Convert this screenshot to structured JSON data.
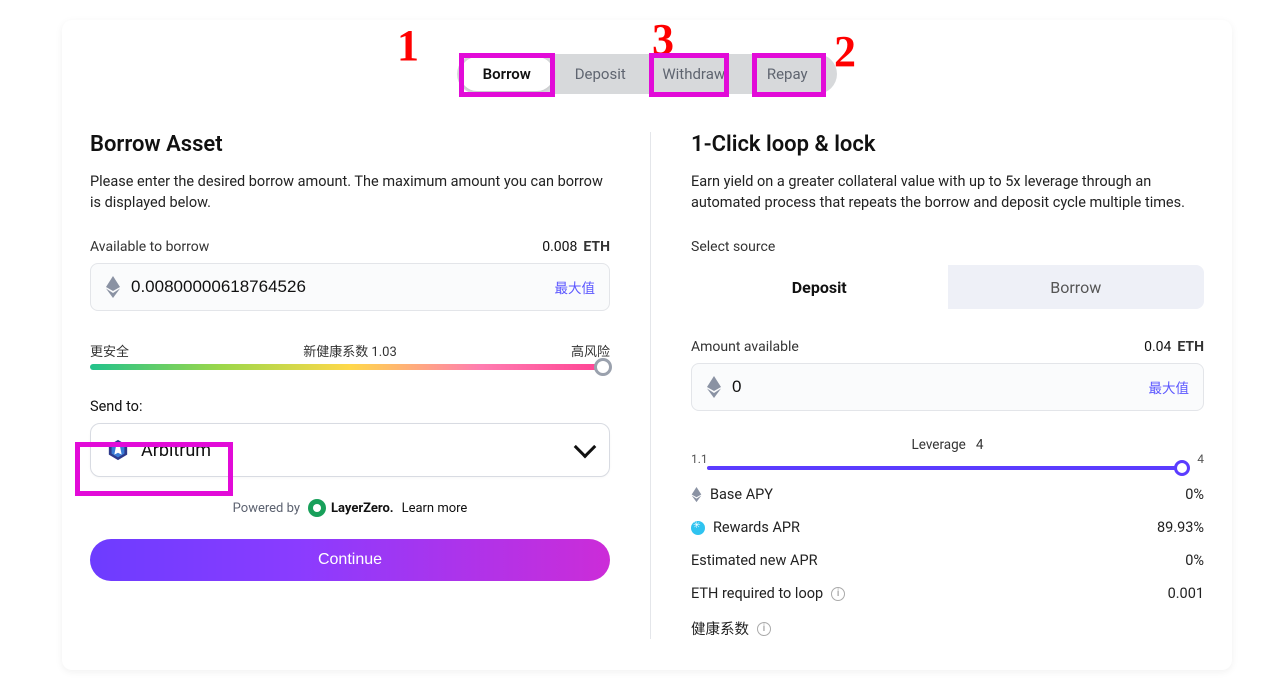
{
  "tabs": {
    "borrow": "Borrow",
    "deposit": "Deposit",
    "withdraw": "Withdraw",
    "repay": "Repay"
  },
  "left": {
    "title": "Borrow Asset",
    "desc": "Please enter the desired borrow amount. The maximum amount you can borrow is displayed below.",
    "available_label": "Available to borrow",
    "available_value": "0.008",
    "available_symbol": "ETH",
    "input_value": "0.00800000618764526",
    "max_label": "最大值",
    "health_left": "更安全",
    "health_mid": "新健康系数 1.03",
    "health_right": "高风险",
    "sendto_label": "Send to:",
    "sendto_selected": "Arbitrum",
    "powered_prefix": "Powered by",
    "layerzero_name": "LayerZero.",
    "learn_more": "Learn more",
    "continue_label": "Continue"
  },
  "right": {
    "title": "1-Click loop & lock",
    "desc": "Earn yield on a greater collateral value with up to 5x leverage through an automated process that repeats the borrow and deposit cycle multiple times.",
    "select_source_label": "Select source",
    "seg_deposit": "Deposit",
    "seg_borrow": "Borrow",
    "amount_available_label": "Amount available",
    "amount_available_value": "0.04",
    "amount_available_symbol": "ETH",
    "amount_input_value": "0",
    "max_label": "最大值",
    "leverage_label": "Leverage",
    "leverage_value": "4",
    "leverage_min": "1.1",
    "leverage_max": "4",
    "stats": {
      "base_apy_label": "Base APY",
      "base_apy_value": "0%",
      "rewards_apr_label": "Rewards APR",
      "rewards_apr_value": "89.93%",
      "est_new_apr_label": "Estimated new APR",
      "est_new_apr_value": "0%",
      "eth_required_label": "ETH required to loop",
      "eth_required_value": "0.001",
      "health_label": "健康系数"
    }
  },
  "annotations": {
    "n1": "1",
    "n2": "2",
    "n3": "3"
  }
}
